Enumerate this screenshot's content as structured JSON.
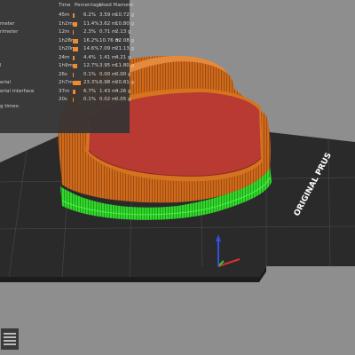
{
  "legend": {
    "headers": {
      "time": "Time",
      "percentage": "Percentage",
      "used_filament": "Used filament"
    },
    "rows": [
      {
        "feature": "",
        "time": "45m",
        "percentage": "6.2%",
        "percent_value": 6.2,
        "length": "3.59 m",
        "mass": "10.72 g"
      },
      {
        "feature": "meter",
        "time": "1h2m",
        "percentage": "11.4%",
        "percent_value": 11.4,
        "length": "3.62 m",
        "mass": "10.80 g"
      },
      {
        "feature": "rimeter",
        "time": "12m",
        "percentage": "2.3%",
        "percent_value": 2.3,
        "length": "0.71 m",
        "mass": "2.13 g"
      },
      {
        "feature": "",
        "time": "1h28m",
        "percentage": "16.2%",
        "percent_value": 16.2,
        "length": "10.76 m",
        "mass": "32.08 g"
      },
      {
        "feature": "",
        "time": "1h20m",
        "percentage": "14.6%",
        "percent_value": 14.6,
        "length": "7.09 m",
        "mass": "21.13 g"
      },
      {
        "feature": "",
        "time": "24m",
        "percentage": "4.4%",
        "percent_value": 4.4,
        "length": "1.41 m",
        "mass": "4.21 g"
      },
      {
        "feature": "l",
        "time": "1h9m",
        "percentage": "12.7%",
        "percent_value": 12.7,
        "length": "3.95 m",
        "mass": "11.80 g"
      },
      {
        "feature": "",
        "time": "26s",
        "percentage": "0.1%",
        "percent_value": 0.1,
        "length": "0.00 m",
        "mass": "0.00 g"
      },
      {
        "feature": "erial",
        "time": "2h7m",
        "percentage": "23.3%",
        "percent_value": 23.3,
        "length": "6.98 m",
        "mass": "20.81 g"
      },
      {
        "feature": "erial interface",
        "time": "37m",
        "percentage": "6.7%",
        "percent_value": 6.7,
        "length": "1.43 m",
        "mass": "4.26 g"
      },
      {
        "feature": "",
        "time": "20s",
        "percentage": "0.1%",
        "percent_value": 0.1,
        "length": "0.02 m",
        "mass": "0.05 g"
      }
    ],
    "print_times_label": "g times:"
  },
  "bed_label": "ORIGINAL PRUS",
  "colors": {
    "background": "#8e8e8e",
    "bed": "#2a2a2a",
    "legend_bg": "#343434",
    "bar": "#f08a2e",
    "support": "#2fd12a",
    "perimeter": "#c8661a",
    "top_solid": "#b83a32",
    "axis_x": "#e03030",
    "axis_y": "#2ad02a",
    "axis_z": "#3050e0"
  }
}
